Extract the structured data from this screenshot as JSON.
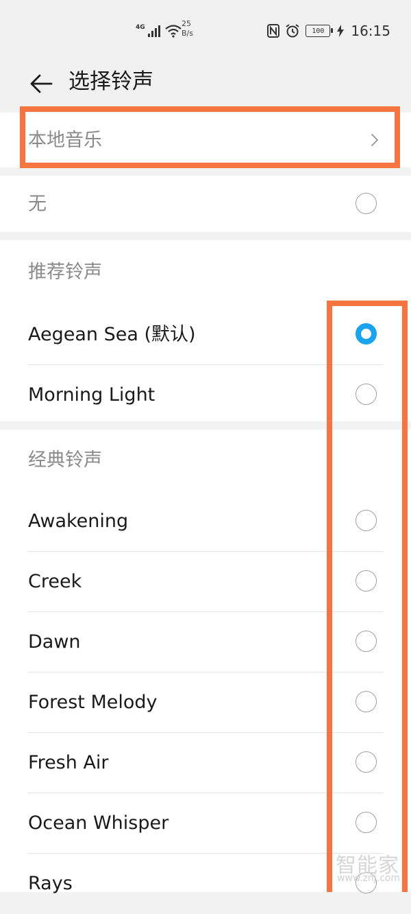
{
  "status_bar": {
    "network_type": "4G",
    "speed_value": "25",
    "speed_unit": "B/s",
    "battery": "100",
    "time": "16:15",
    "icons": [
      "signal-icon",
      "wifi-icon",
      "nfc-icon",
      "alarm-icon",
      "battery-icon",
      "charging-icon"
    ]
  },
  "header": {
    "title": "选择铃声",
    "back_icon": "back-arrow-icon"
  },
  "local_music": {
    "label": "本地音乐",
    "chevron_icon": "chevron-right-icon"
  },
  "none_option": {
    "label": "无",
    "selected": false
  },
  "recommended": {
    "header": "推荐铃声",
    "items": [
      {
        "label": "Aegean Sea (默认)",
        "selected": true
      },
      {
        "label": "Morning Light",
        "selected": false
      }
    ]
  },
  "classic": {
    "header": "经典铃声",
    "items": [
      {
        "label": "Awakening",
        "selected": false
      },
      {
        "label": "Creek",
        "selected": false
      },
      {
        "label": "Dawn",
        "selected": false
      },
      {
        "label": "Forest Melody",
        "selected": false
      },
      {
        "label": "Fresh Air",
        "selected": false
      },
      {
        "label": "Ocean Whisper",
        "selected": false
      },
      {
        "label": "Rays",
        "selected": false
      }
    ]
  },
  "watermark": {
    "text": "智能家",
    "url": "www.znj.com"
  },
  "colors": {
    "accent": "#1aa3ef",
    "highlight": "#f5743f",
    "background": "#f2f2f2"
  }
}
